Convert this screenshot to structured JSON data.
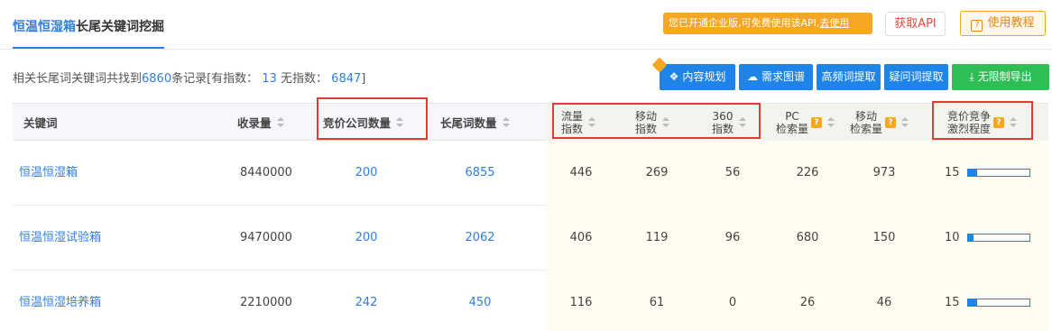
{
  "tab": {
    "highlight": "恒温恒湿箱",
    "rest": "长尾关键词挖掘"
  },
  "notice": {
    "text": "您已开通企业版,可免费使用该API,",
    "link": "去使用"
  },
  "buttons": {
    "get_api": "获取API",
    "guide": "使用教程",
    "guide_icon": "?"
  },
  "summary": {
    "prefix": "相关长尾词关键词共找到",
    "total": "6860",
    "middle": "条记录[有指数：",
    "with_index": "13",
    "no_index_label": "无指数：",
    "no_index": "6847",
    "suffix": "]"
  },
  "actions": [
    {
      "label": "内容规划",
      "icon": "share-icon",
      "glyph": "❖"
    },
    {
      "label": "需求图谱",
      "icon": "cloud-icon",
      "glyph": "☁"
    },
    {
      "label": "高频词提取",
      "icon": "",
      "glyph": ""
    },
    {
      "label": "疑问词提取",
      "icon": "",
      "glyph": ""
    },
    {
      "label": "无限制导出",
      "icon": "download-icon",
      "glyph": "⤓"
    }
  ],
  "columns": {
    "keyword": "关键词",
    "indexed": "收录量",
    "bid_companies": "竞价公司数量",
    "longtail": "长尾词数量",
    "traffic": [
      "流量",
      "指数"
    ],
    "mobile": [
      "移动",
      "指数"
    ],
    "idx360": [
      "360",
      "指数"
    ],
    "pc_search": [
      "PC",
      "检索量"
    ],
    "mobile_search": [
      "移动",
      "检索量"
    ],
    "competition": [
      "竞价竞争",
      "激烈程度"
    ],
    "help_icon": "?"
  },
  "rows": [
    {
      "keyword": "恒温恒湿箱",
      "indexed": "8440000",
      "bid_companies": "200",
      "longtail": "6855",
      "traffic": "446",
      "mobile": "269",
      "idx360": "56",
      "pc_search": "226",
      "mobile_search": "973",
      "competition": "15",
      "competition_level": 0.15
    },
    {
      "keyword": "恒温恒湿试验箱",
      "indexed": "9470000",
      "bid_companies": "200",
      "longtail": "2062",
      "traffic": "406",
      "mobile": "119",
      "idx360": "96",
      "pc_search": "680",
      "mobile_search": "150",
      "competition": "10",
      "competition_level": 0.1
    },
    {
      "keyword": "恒温恒湿培养箱",
      "indexed": "2210000",
      "bid_companies": "242",
      "longtail": "450",
      "traffic": "116",
      "mobile": "61",
      "idx360": "0",
      "pc_search": "26",
      "mobile_search": "46",
      "competition": "15",
      "competition_level": 0.15
    }
  ],
  "colors": {
    "accent": "#2f7ee8",
    "warning": "#f5a623",
    "success": "#2ebe55",
    "highlight_box": "#e53935"
  }
}
